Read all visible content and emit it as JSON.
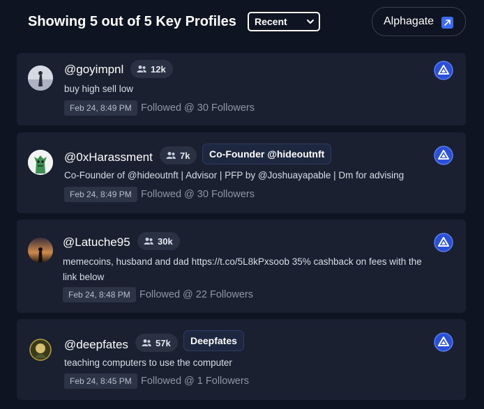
{
  "header": {
    "title": "Showing 5 out of 5 Key Profiles",
    "sort_select": "Recent",
    "alphagate_button": "Alphagate"
  },
  "profiles": [
    {
      "handle": "@goyimpnl",
      "followers": "12k",
      "tag": "",
      "bio": "buy high sell low",
      "date": "Feb 24, 8:49 PM",
      "followed": "Followed @ 30 Followers"
    },
    {
      "handle": "@0xHarassment",
      "followers": "7k",
      "tag": "Co-Founder @hideoutnft",
      "bio": "Co-Founder of @hideoutnft | Advisor | PFP by @Joshuayapable | Dm for advising",
      "date": "Feb 24, 8:49 PM",
      "followed": "Followed @ 30 Followers"
    },
    {
      "handle": "@Latuche95",
      "followers": "30k",
      "tag": "",
      "bio": "memecoins, husband and dad https://t.co/5L8kPxsoob 35% cashback on fees with the link below",
      "date": "Feb 24, 8:48 PM",
      "followed": "Followed @ 22 Followers"
    },
    {
      "handle": "@deepfates",
      "followers": "57k",
      "tag": "Deepfates",
      "bio": "teaching computers to use the computer",
      "date": "Feb 24, 8:45 PM",
      "followed": "Followed @ 1 Followers"
    }
  ],
  "colors": {
    "background": "#0f1422",
    "card": "#1a2030",
    "accent": "#3b6cf6"
  },
  "icons": {
    "followers": "people-icon",
    "external": "external-link-icon",
    "profile_action": "alphagate-logo-icon",
    "select": "chevron-down-icon"
  }
}
